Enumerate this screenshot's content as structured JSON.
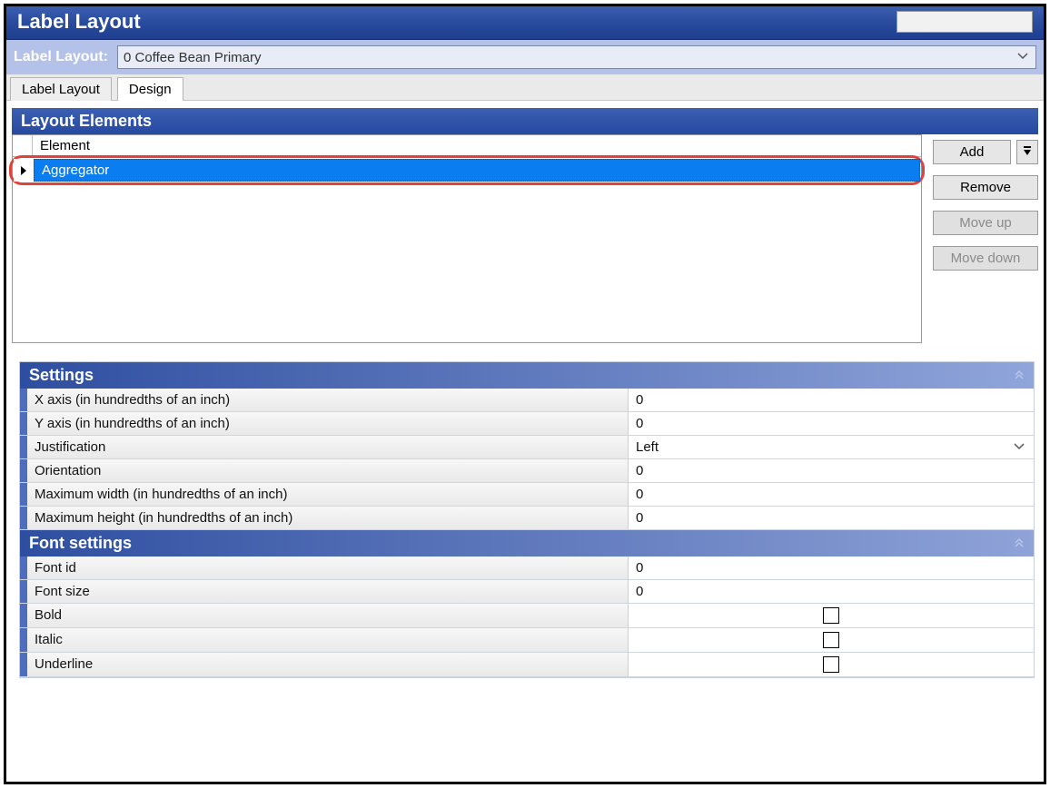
{
  "title": "Label Layout",
  "layoutSelector": {
    "label": "Label Layout:",
    "value": "0  Coffee Bean Primary"
  },
  "tabs": {
    "labelLayout": "Label Layout",
    "design": "Design"
  },
  "elementsPanel": {
    "title": "Layout Elements",
    "columnHeader": "Element",
    "rows": [
      "Aggregator"
    ],
    "buttons": {
      "add": "Add",
      "remove": "Remove",
      "moveUp": "Move up",
      "moveDown": "Move down"
    }
  },
  "settings": {
    "header": "Settings",
    "rows": {
      "xAxis": {
        "label": "X axis (in hundredths of an inch)",
        "value": "0"
      },
      "yAxis": {
        "label": "Y axis (in hundredths of an inch)",
        "value": "0"
      },
      "just": {
        "label": "Justification",
        "value": "Left"
      },
      "orient": {
        "label": "Orientation",
        "value": "0"
      },
      "maxW": {
        "label": "Maximum width (in hundredths of an inch)",
        "value": "0"
      },
      "maxH": {
        "label": "Maximum height (in hundredths of an inch)",
        "value": "0"
      }
    }
  },
  "fontSettings": {
    "header": "Font settings",
    "rows": {
      "fontId": {
        "label": "Font id",
        "value": "0"
      },
      "fontSize": {
        "label": "Font size",
        "value": "0"
      },
      "bold": {
        "label": "Bold"
      },
      "italic": {
        "label": "Italic"
      },
      "underline": {
        "label": "Underline"
      }
    }
  }
}
